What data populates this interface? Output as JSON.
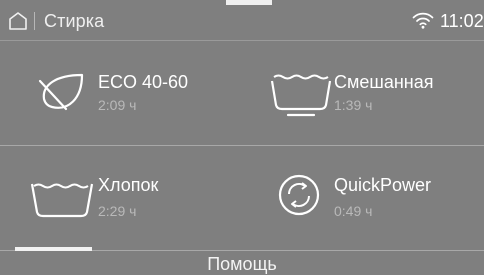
{
  "header": {
    "home_icon": "home-icon",
    "title": "Стирка",
    "wifi_icon": "wifi-icon",
    "time": "11:02"
  },
  "programs": [
    {
      "name": "ECO 40-60",
      "duration": "2:09 ч",
      "icon": "leaf-icon"
    },
    {
      "name": "Смешанная",
      "duration": "1:39 ч",
      "icon": "basin-icon"
    },
    {
      "name": "Хлопок",
      "duration": "2:29 ч",
      "icon": "wash-tub-icon"
    },
    {
      "name": "QuickPower",
      "duration": "0:49 ч",
      "icon": "quickpower-icon"
    }
  ],
  "footer": {
    "help_label": "Помощь"
  },
  "colors": {
    "background": "#7f7f7f",
    "text": "#ffffff",
    "secondary_text": "#b9b9b9",
    "divider": "#a8a8a8"
  }
}
